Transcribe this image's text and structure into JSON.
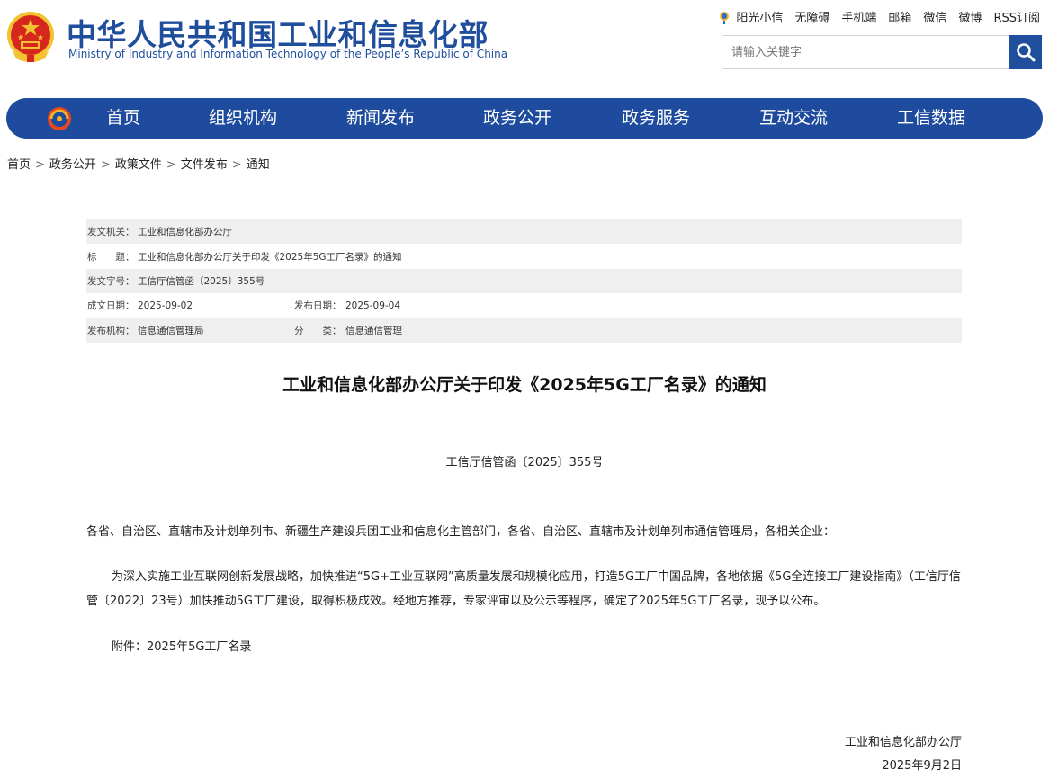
{
  "header": {
    "title": "中华人民共和国工业和信息化部",
    "subtitle": "Ministry of Industry and Information Technology of the People’s Republic of China",
    "toplinks": [
      "阳光小信",
      "无障碍",
      "手机端",
      "邮箱",
      "微信",
      "微博",
      "RSS订阅"
    ],
    "search_placeholder": "请输入关键字",
    "colors": {
      "brand": "#1e4b9d",
      "emblem_red": "#d7261e",
      "emblem_gold": "#f2c230"
    }
  },
  "nav": {
    "items": [
      "首页",
      "组织机构",
      "新闻发布",
      "政务公开",
      "政务服务",
      "互动交流",
      "工信数据"
    ]
  },
  "breadcrumb": [
    "首页",
    "政务公开",
    "政策文件",
    "文件发布",
    "通知"
  ],
  "meta": {
    "issuer_label": "发文机关：",
    "issuer": "工业和信息化部办公厅",
    "title_label": "标　　题：",
    "title": "工业和信息化部办公厅关于印发《2025年5G工厂名录》的通知",
    "docno_label": "发文字号：",
    "docno": "工信厅信管函〔2025〕355号",
    "written_label": "成文日期：",
    "written": "2025-09-02",
    "published_label": "发布日期：",
    "published": "2025-09-04",
    "org_label": "发布机构：",
    "org": "信息通信管理局",
    "category_label": "分　　类：",
    "category": "信息通信管理"
  },
  "article": {
    "title": "工业和信息化部办公厅关于印发《2025年5G工厂名录》的通知",
    "doc_number": "工信厅信管函〔2025〕355号",
    "para1": "各省、自治区、直辖市及计划单列市、新疆生产建设兵团工业和信息化主管部门，各省、自治区、直辖市及计划单列市通信管理局，各相关企业：",
    "para2": "为深入实施工业互联网创新发展战略，加快推进“5G+工业互联网”高质量发展和规模化应用，打造5G工厂中国品牌，各地依据《5G全连接工厂建设指南》（工信厅信管〔2022〕23号）加快推动5G工厂建设，取得积极成效。经地方推荐，专家评审以及公示等程序，确定了2025年5G工厂名录，现予以公布。",
    "para3": "附件：2025年5G工厂名录",
    "signature": "工业和信息化部办公厅",
    "date": "2025年9月2日"
  }
}
